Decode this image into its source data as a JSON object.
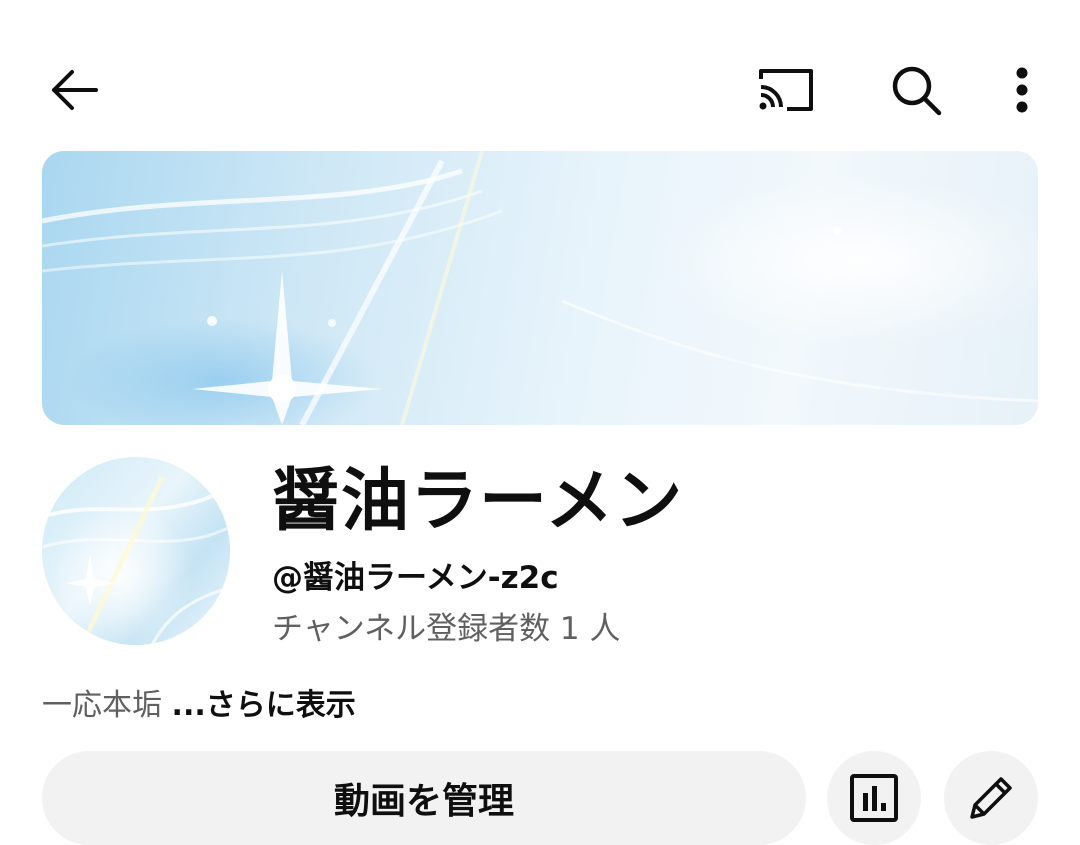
{
  "topbar": {
    "icons": [
      "back-arrow-icon",
      "cast-icon",
      "search-icon",
      "more-vertical-icon"
    ]
  },
  "channel": {
    "name": "醤油ラーメン",
    "handle": "@醤油ラーメン-z2c",
    "subscribers": "チャンネル登録者数 1 人"
  },
  "description": {
    "text": "一応本垢 ",
    "more_label": "...さらに表示"
  },
  "actions": {
    "manage_label": "動画を管理",
    "icons": [
      "analytics-icon",
      "pencil-icon"
    ]
  },
  "colors": {
    "background": "#ffffff",
    "button_bg": "#f2f2f2",
    "secondary_text": "#606060",
    "primary_text": "#0f0f0f"
  }
}
